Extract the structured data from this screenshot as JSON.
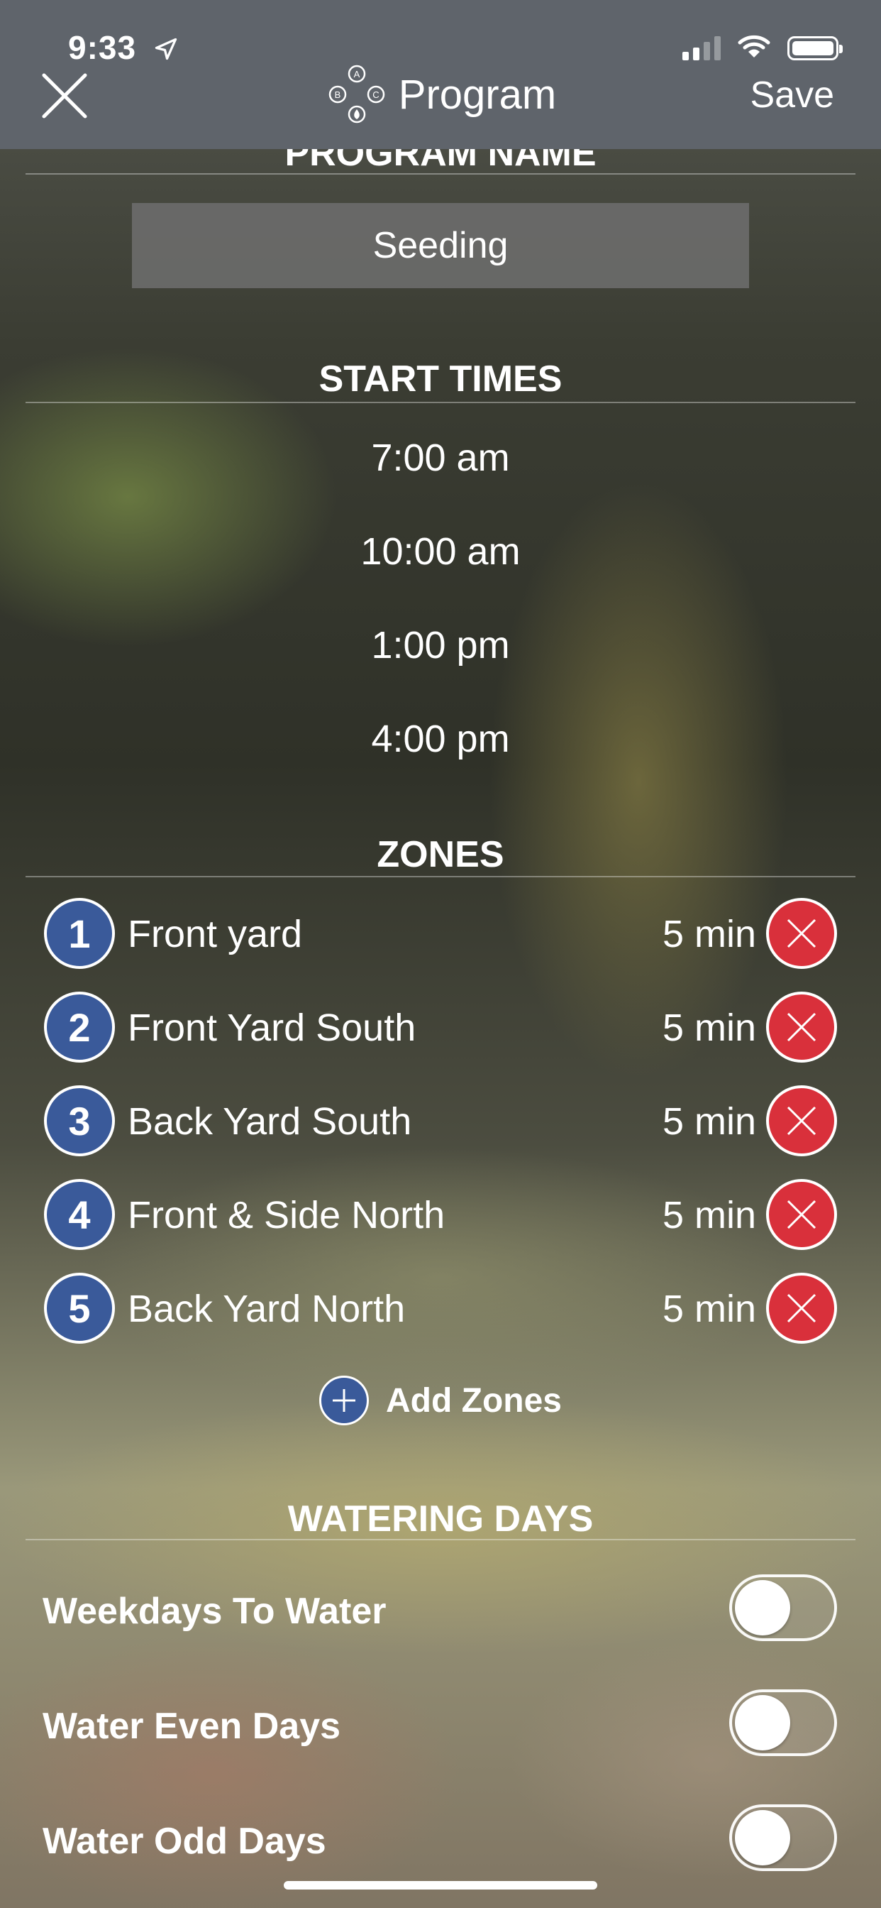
{
  "status_bar": {
    "time": "9:33"
  },
  "header": {
    "title": "Program",
    "save_label": "Save"
  },
  "program_name": {
    "section_title": "PROGRAM NAME",
    "value": "Seeding"
  },
  "start_times": {
    "section_title": "START TIMES",
    "times": [
      "7:00 am",
      "10:00 am",
      "1:00 pm",
      "4:00 pm"
    ]
  },
  "zones": {
    "section_title": "ZONES",
    "items": [
      {
        "number": "1",
        "name": "Front yard",
        "duration": "5 min"
      },
      {
        "number": "2",
        "name": "Front Yard South",
        "duration": "5 min"
      },
      {
        "number": "3",
        "name": "Back Yard South",
        "duration": "5 min"
      },
      {
        "number": "4",
        "name": "Front & Side North",
        "duration": "5 min"
      },
      {
        "number": "5",
        "name": "Back Yard North",
        "duration": "5 min"
      }
    ],
    "add_label": "Add Zones"
  },
  "watering_days": {
    "section_title": "WATERING DAYS",
    "options": [
      {
        "label": "Weekdays To Water",
        "enabled": false
      },
      {
        "label": "Water Even Days",
        "enabled": false
      },
      {
        "label": "Water Odd Days",
        "enabled": false
      }
    ]
  },
  "colors": {
    "header_bg": "#5f646b",
    "zone_badge": "#3a5a9a",
    "remove_red": "#d9303b"
  },
  "icons": [
    "location-arrow-icon",
    "cellular-signal-icon",
    "wifi-icon",
    "battery-icon",
    "close-icon",
    "program-logo-icon",
    "remove-icon",
    "add-icon",
    "toggle-switch"
  ]
}
